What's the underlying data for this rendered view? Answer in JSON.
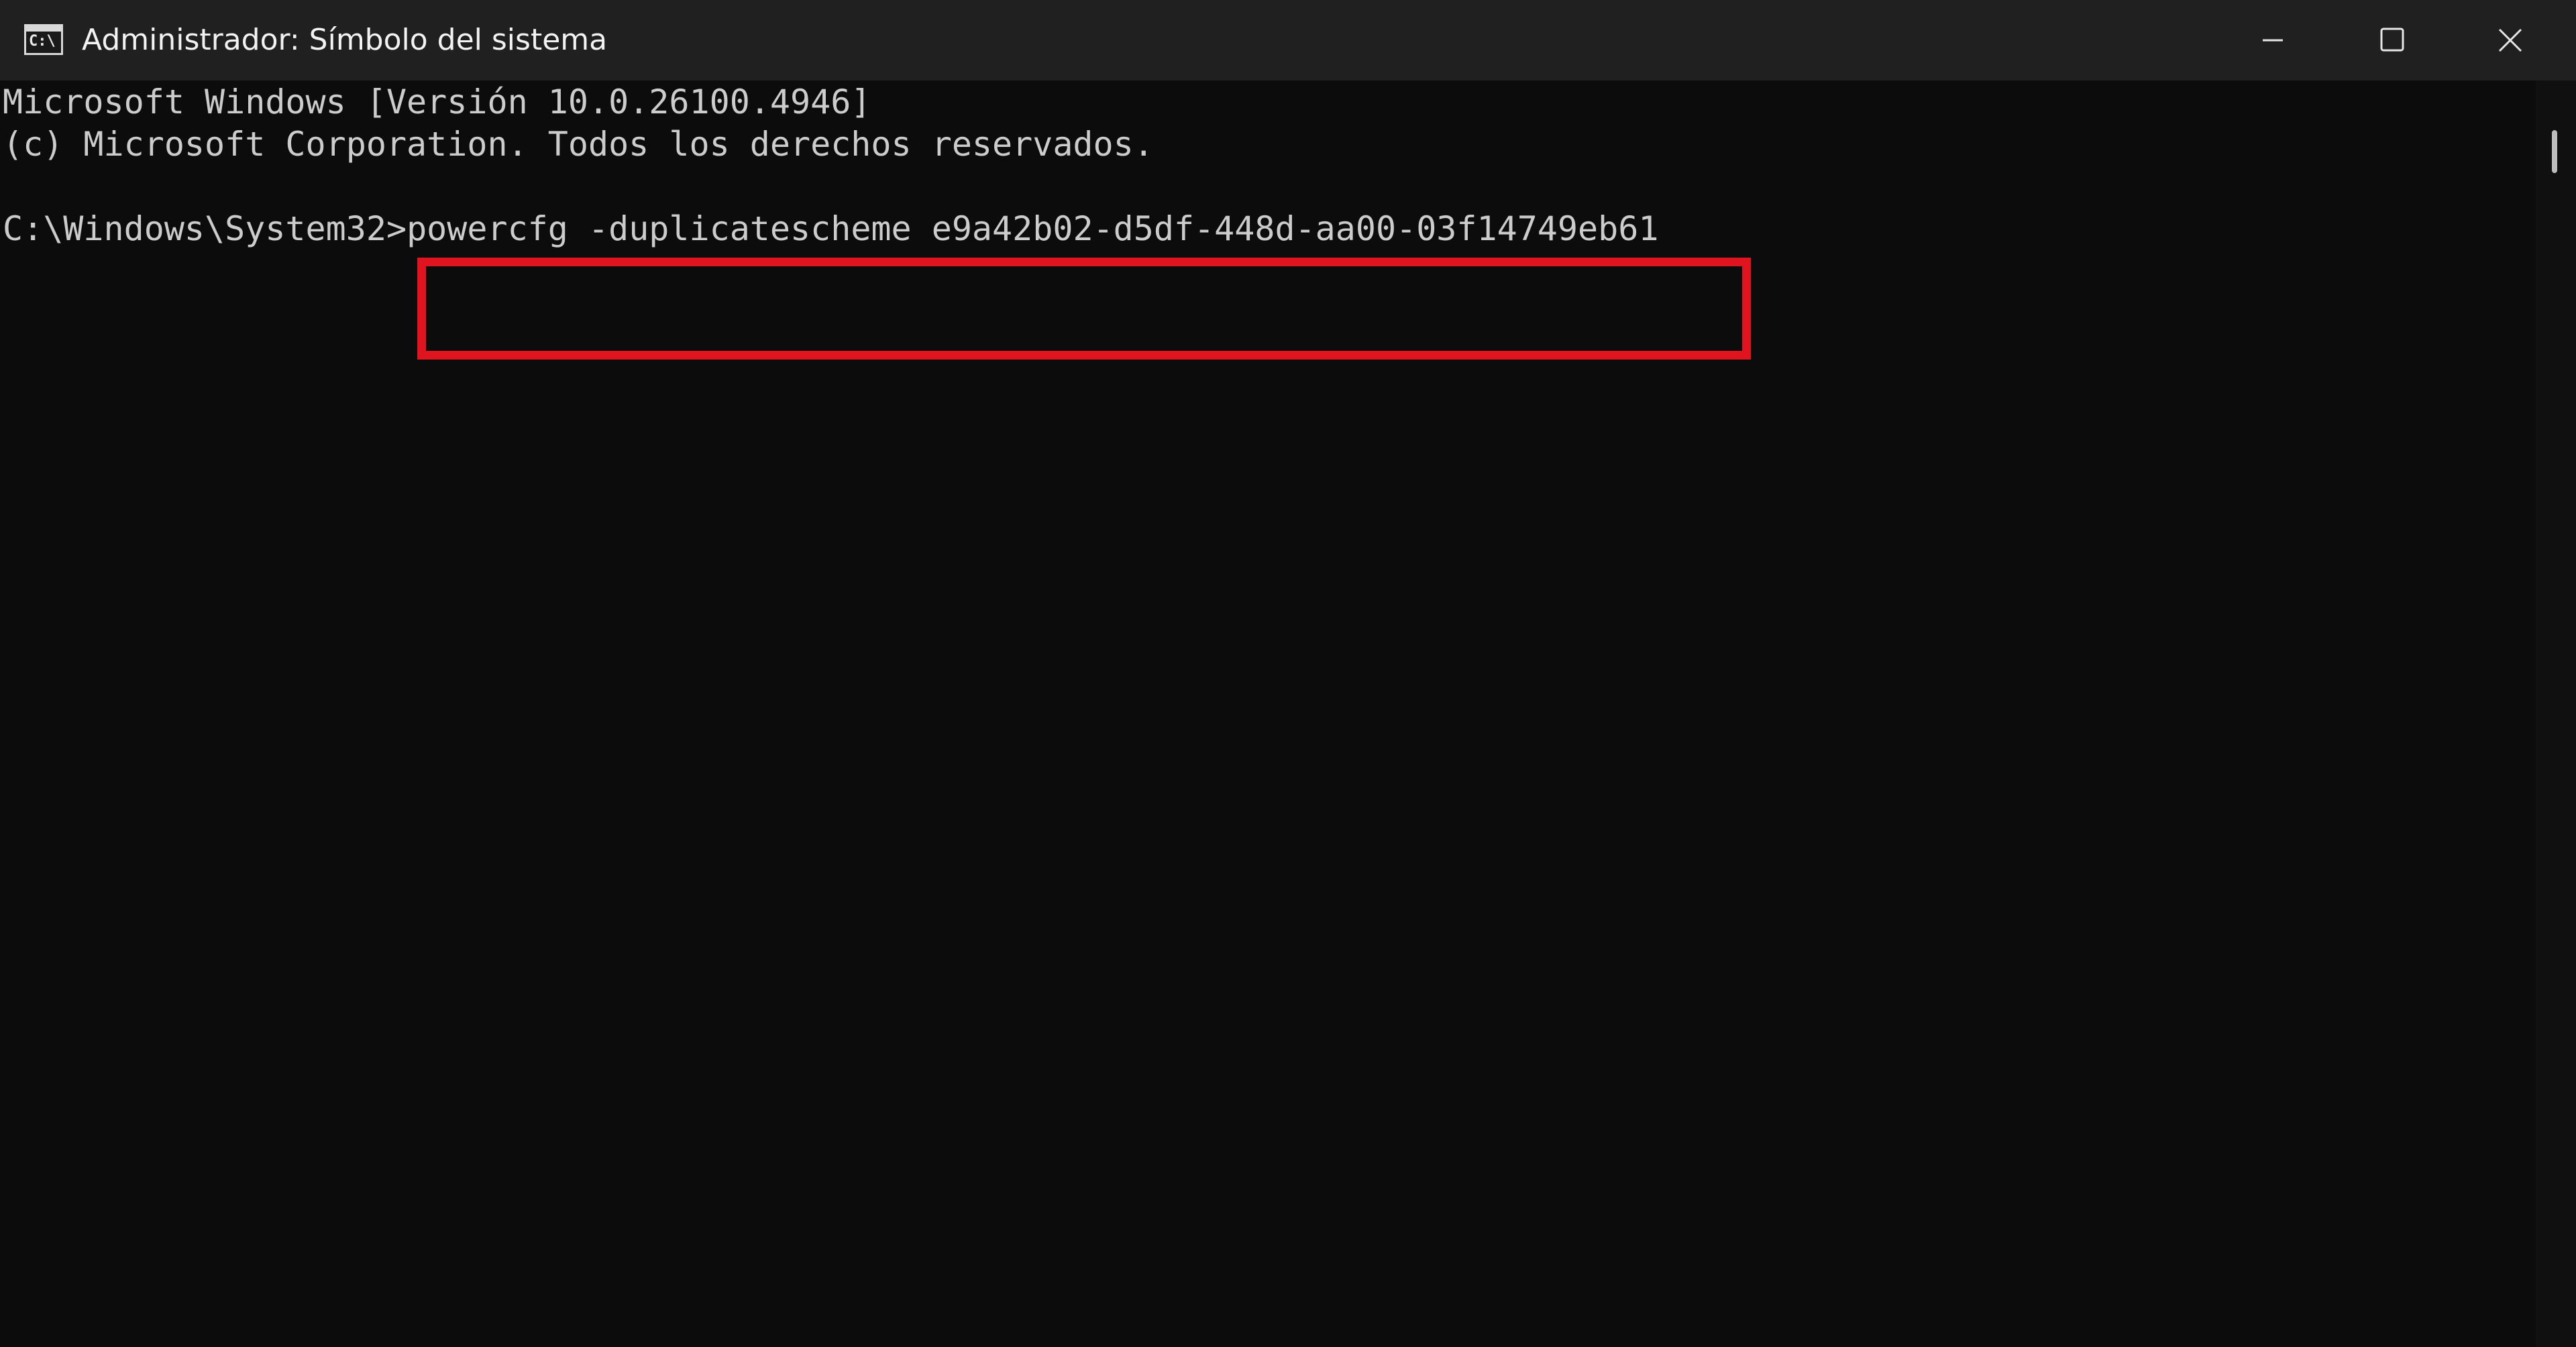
{
  "window": {
    "title": "Administrador: Símbolo del sistema",
    "icon": "cmd-icon",
    "icon_glyph": "C:\\",
    "buttons": {
      "minimize": "minimize-icon",
      "maximize": "maximize-icon",
      "close": "close-icon"
    }
  },
  "console": {
    "lines": [
      "Microsoft Windows [Versión 10.0.26100.4946]",
      "(c) Microsoft Corporation. Todos los derechos reservados."
    ],
    "prompt": "C:\\Windows\\System32>",
    "command": "powercfg -duplicatescheme e9a42b02-d5df-448d-aa00-03f14749eb61"
  },
  "colors": {
    "titlebar": "#202020",
    "background": "#0c0c0c",
    "text": "#cccccc",
    "highlight": "#e0141e"
  }
}
